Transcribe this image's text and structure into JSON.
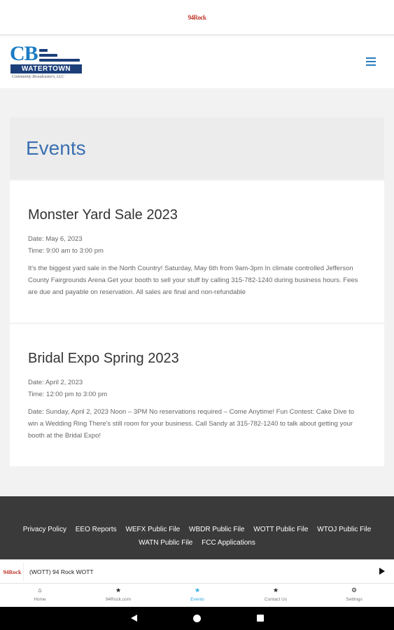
{
  "topbar": {
    "mini_logo": "94Rock"
  },
  "header": {
    "logo": {
      "letters": "CB",
      "banner": "WATERTOWN",
      "tagline": "Community Broadcasters, LLC"
    },
    "menu_icon": "hamburger-menu-icon"
  },
  "page": {
    "title": "Events"
  },
  "events": [
    {
      "title": "Monster Yard Sale 2023",
      "date": "Date: May 6, 2023",
      "time": "Time: 9:00 am to 3:00 pm",
      "description": "It's the biggest yard sale in the North Country! Saturday, May 6th from 9am-3pm In climate controlled Jefferson County Fairgrounds Arena Get your booth to sell your stuff by calling 315-782-1240 during business hours. Fees are due and payable on reservation. All sales are final and non-refundable"
    },
    {
      "title": "Bridal Expo Spring 2023",
      "date": "Date: April 2, 2023",
      "time": "Time: 12:00 pm to 3:00 pm",
      "description": "Date: Sunday, April 2, 2023 Noon – 3PM No reservations required – Come Anytime! Fun Contest: Cake Dive to win a Wedding Ring There's still room for your business. Call Sandy at 315-782-1240 to talk about getting your booth at the Bridal Expo!"
    }
  ],
  "footer": {
    "links": [
      "Privacy Policy",
      "EEO Reports",
      "WEFX Public File",
      "WBDR Public File",
      "WOTT Public File",
      "WTOJ Public File",
      "WATN Public File",
      "FCC Applications"
    ]
  },
  "player": {
    "station_logo": "94Rock",
    "now_playing": "(WOTT) 94 Rock WOTT",
    "play_icon": "play-icon"
  },
  "tabs": [
    {
      "label": "Home",
      "icon": "home-icon",
      "glyph": "⌂"
    },
    {
      "label": "94Rock.com",
      "icon": "star-icon",
      "glyph": "★"
    },
    {
      "label": "Events",
      "icon": "star-icon",
      "glyph": "★",
      "active": true
    },
    {
      "label": "Contact Us",
      "icon": "star-icon",
      "glyph": "★"
    },
    {
      "label": "Settings",
      "icon": "gear-icon",
      "glyph": "⚙"
    }
  ],
  "colors": {
    "accent": "#2ea8e0",
    "title_blue": "#3a6fb0",
    "logo_navy": "#1c3f7a",
    "footer_bg": "#3a3a3a"
  }
}
